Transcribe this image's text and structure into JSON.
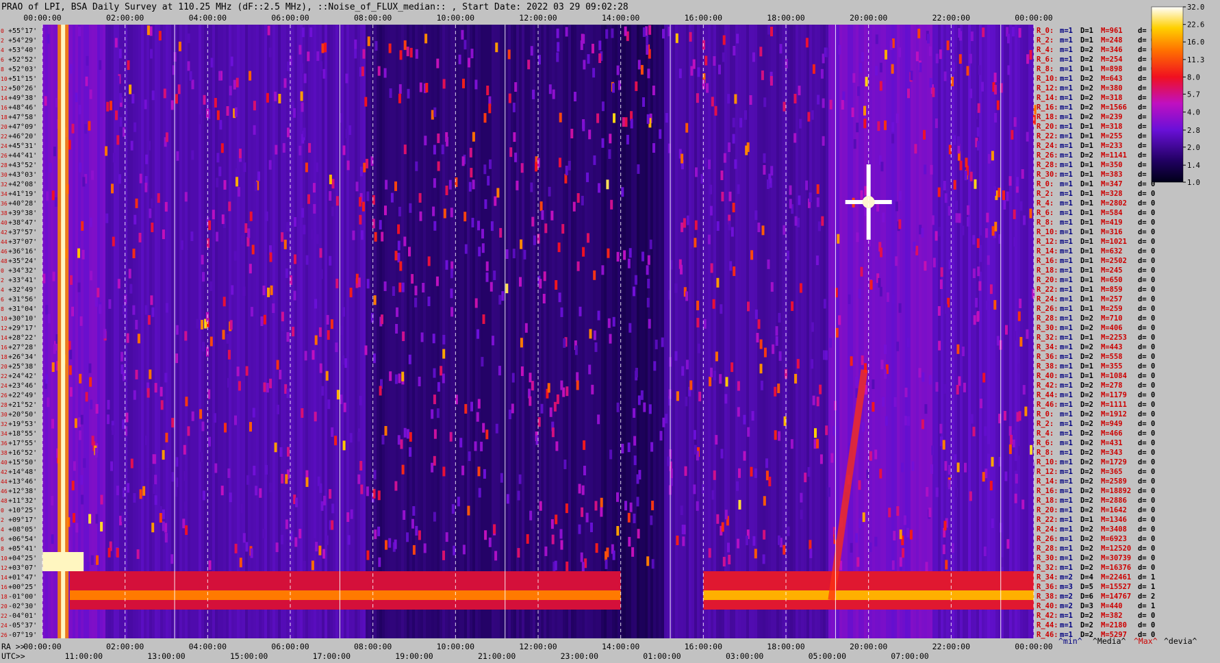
{
  "chart_data": {
    "type": "heatmap",
    "title": "PRAO of LPI, BSA Daily Survey at 110.25 MHz (dF::2.5 MHz), ::Noise_of_FLUX_median:: , Start Date: 2022 03 29 09:02:28",
    "x_axis_label_top": "",
    "x_axis_label_ra": "RA >>",
    "x_axis_label_utc": "UTC>>",
    "ra_ticks": [
      "00:00:00",
      "02:00:00",
      "04:00:00",
      "06:00:00",
      "08:00:00",
      "10:00:00",
      "12:00:00",
      "14:00:00",
      "16:00:00",
      "18:00:00",
      "20:00:00",
      "22:00:00",
      "00:00:00"
    ],
    "ra_ticks_bottom": [
      "00:00:00",
      "02:00:00",
      "04:00:00",
      "06:00:00",
      "08:00:00",
      "10:00:00",
      "12:00:00",
      "14:00:00",
      "16:00:00",
      "18:00:00",
      "20:00:00",
      "22:00:00",
      "00:00:00"
    ],
    "utc_ticks": [
      "11:00:00",
      "13:00:00",
      "15:00:00",
      "17:00:00",
      "19:00:00",
      "21:00:00",
      "23:00:00",
      "01:00:00",
      "03:00:00",
      "05:00:00",
      "07:00:00"
    ],
    "declinations": [
      "+55°17'",
      "+54°29'",
      "+53°40'",
      "+52°52'",
      "+52°03'",
      "+51°15'",
      "+50°26'",
      "+49°38'",
      "+48°46'",
      "+47°58'",
      "+47°09'",
      "+46°20'",
      "+45°31'",
      "+44°41'",
      "+43°52'",
      "+43°03'",
      "+42°08'",
      "+41°19'",
      "+40°28'",
      "+39°38'",
      "+38°47'",
      "+37°57'",
      "+37°07'",
      "+36°16'",
      "+35°24'",
      "+34°32'",
      "+33°41'",
      "+32°49'",
      "+31°56'",
      "+31°04'",
      "+30°10'",
      "+29°17'",
      "+28°22'",
      "+27°28'",
      "+26°34'",
      "+25°38'",
      "+24°42'",
      "+23°46'",
      "+22°49'",
      "+21°52'",
      "+20°50'",
      "+19°53'",
      "+18°55'",
      "+17°55'",
      "+16°52'",
      "+15°50'",
      "+14°48'",
      "+13°46'",
      "+12°38'",
      "+11°32'",
      "+10°25'",
      "+09°17'",
      "+08°05'",
      "+06°54'",
      "+05°41'",
      "+04°25'",
      "+03°07'",
      "+01°47'",
      "+00°25'",
      "-01°00'",
      "-02°30'",
      "-04°01'",
      "-05°37'",
      "-07°19'"
    ],
    "row_index": [
      "0",
      "2",
      "4",
      "6",
      "8",
      "10",
      "12",
      "14",
      "16",
      "18",
      "20",
      "22",
      "24",
      "26",
      "28",
      "30",
      "32",
      "34",
      "36",
      "38",
      "40",
      "42",
      "44",
      "46",
      "48",
      "0",
      "2",
      "4",
      "6",
      "8",
      "10",
      "12",
      "14",
      "16",
      "18",
      "20",
      "22",
      "24",
      "26",
      "28",
      "30",
      "32",
      "34",
      "36",
      "38",
      "40",
      "42",
      "44",
      "46",
      "48",
      "0",
      "2",
      "4",
      "6",
      "8",
      "10",
      "12",
      "14",
      "16",
      "18",
      "20",
      "22",
      "24",
      "26"
    ],
    "stats": [
      {
        "r": "R_0:",
        "m": "m=1",
        "D": "D=1",
        "M": "M=961",
        "d": "d= 0"
      },
      {
        "r": "R_2:",
        "m": "m=1",
        "D": "D=1",
        "M": "M=248",
        "d": "d= 0"
      },
      {
        "r": "R_4:",
        "m": "m=1",
        "D": "D=2",
        "M": "M=346",
        "d": "d= 0"
      },
      {
        "r": "R_6:",
        "m": "m=1",
        "D": "D=2",
        "M": "M=254",
        "d": "d= 0"
      },
      {
        "r": "R_8:",
        "m": "m=1",
        "D": "D=1",
        "M": "M=898",
        "d": "d= 0"
      },
      {
        "r": "R_10:",
        "m": "m=1",
        "D": "D=2",
        "M": "M=643",
        "d": "d="
      },
      {
        "r": "R_12:",
        "m": "m=1",
        "D": "D=2",
        "M": "M=380",
        "d": "d="
      },
      {
        "r": "R_14:",
        "m": "m=1",
        "D": "D=2",
        "M": "M=318",
        "d": "d="
      },
      {
        "r": "R_16:",
        "m": "m=1",
        "D": "D=2",
        "M": "M=1566",
        "d": "d="
      },
      {
        "r": "R_18:",
        "m": "m=1",
        "D": "D=2",
        "M": "M=239",
        "d": "d="
      },
      {
        "r": "R_20:",
        "m": "m=1",
        "D": "D=1",
        "M": "M=318",
        "d": "d="
      },
      {
        "r": "R_22:",
        "m": "m=1",
        "D": "D=1",
        "M": "M=255",
        "d": "d="
      },
      {
        "r": "R_24:",
        "m": "m=1",
        "D": "D=1",
        "M": "M=233",
        "d": "d="
      },
      {
        "r": "R_26:",
        "m": "m=1",
        "D": "D=2",
        "M": "M=1141",
        "d": "d="
      },
      {
        "r": "R_28:",
        "m": "m=1",
        "D": "D=1",
        "M": "M=350",
        "d": "d="
      },
      {
        "r": "R_30:",
        "m": "m=1",
        "D": "D=1",
        "M": "M=383",
        "d": "d="
      },
      {
        "r": "R_0:",
        "m": "m=1",
        "D": "D=1",
        "M": "M=347",
        "d": "d= 0"
      },
      {
        "r": "R_2:",
        "m": "m=1",
        "D": "D=1",
        "M": "M=328",
        "d": "d= 0"
      },
      {
        "r": "R_4:",
        "m": "m=1",
        "D": "D=1",
        "M": "M=2802",
        "d": "d= 0"
      },
      {
        "r": "R_6:",
        "m": "m=1",
        "D": "D=1",
        "M": "M=584",
        "d": "d= 0"
      },
      {
        "r": "R_8:",
        "m": "m=1",
        "D": "D=1",
        "M": "M=419",
        "d": "d= 0"
      },
      {
        "r": "R_10:",
        "m": "m=1",
        "D": "D=1",
        "M": "M=316",
        "d": "d= 0"
      },
      {
        "r": "R_12:",
        "m": "m=1",
        "D": "D=1",
        "M": "M=1021",
        "d": "d= 0"
      },
      {
        "r": "R_14:",
        "m": "m=1",
        "D": "D=1",
        "M": "M=632",
        "d": "d= 0"
      },
      {
        "r": "R_16:",
        "m": "m=1",
        "D": "D=1",
        "M": "M=2502",
        "d": "d= 0"
      },
      {
        "r": "R_18:",
        "m": "m=1",
        "D": "D=1",
        "M": "M=245",
        "d": "d= 0"
      },
      {
        "r": "R_20:",
        "m": "m=1",
        "D": "D=1",
        "M": "M=650",
        "d": "d= 0"
      },
      {
        "r": "R_22:",
        "m": "m=1",
        "D": "D=1",
        "M": "M=859",
        "d": "d= 0"
      },
      {
        "r": "R_24:",
        "m": "m=1",
        "D": "D=1",
        "M": "M=257",
        "d": "d= 0"
      },
      {
        "r": "R_26:",
        "m": "m=1",
        "D": "D=1",
        "M": "M=259",
        "d": "d= 0"
      },
      {
        "r": "R_28:",
        "m": "m=1",
        "D": "D=2",
        "M": "M=710",
        "d": "d= 0"
      },
      {
        "r": "R_30:",
        "m": "m=1",
        "D": "D=2",
        "M": "M=406",
        "d": "d= 0"
      },
      {
        "r": "R_32:",
        "m": "m=1",
        "D": "D=1",
        "M": "M=2253",
        "d": "d= 0"
      },
      {
        "r": "R_34:",
        "m": "m=1",
        "D": "D=2",
        "M": "M=443",
        "d": "d= 0"
      },
      {
        "r": "R_36:",
        "m": "m=1",
        "D": "D=2",
        "M": "M=558",
        "d": "d= 0"
      },
      {
        "r": "R_38:",
        "m": "m=1",
        "D": "D=1",
        "M": "M=355",
        "d": "d= 0"
      },
      {
        "r": "R_40:",
        "m": "m=1",
        "D": "D=1",
        "M": "M=1084",
        "d": "d= 0"
      },
      {
        "r": "R_42:",
        "m": "m=1",
        "D": "D=2",
        "M": "M=278",
        "d": "d= 0"
      },
      {
        "r": "R_44:",
        "m": "m=1",
        "D": "D=2",
        "M": "M=1179",
        "d": "d= 0"
      },
      {
        "r": "R_46:",
        "m": "m=1",
        "D": "D=2",
        "M": "M=1111",
        "d": "d= 0"
      },
      {
        "r": "R_0:",
        "m": "m=1",
        "D": "D=2",
        "M": "M=1912",
        "d": "d= 0"
      },
      {
        "r": "R_2:",
        "m": "m=1",
        "D": "D=2",
        "M": "M=949",
        "d": "d= 0"
      },
      {
        "r": "R_4:",
        "m": "m=1",
        "D": "D=2",
        "M": "M=466",
        "d": "d= 0"
      },
      {
        "r": "R_6:",
        "m": "m=1",
        "D": "D=2",
        "M": "M=431",
        "d": "d= 0"
      },
      {
        "r": "R_8:",
        "m": "m=1",
        "D": "D=2",
        "M": "M=343",
        "d": "d= 0"
      },
      {
        "r": "R_10:",
        "m": "m=1",
        "D": "D=2",
        "M": "M=1729",
        "d": "d= 0"
      },
      {
        "r": "R_12:",
        "m": "m=1",
        "D": "D=2",
        "M": "M=365",
        "d": "d= 0"
      },
      {
        "r": "R_14:",
        "m": "m=1",
        "D": "D=2",
        "M": "M=2589",
        "d": "d= 0"
      },
      {
        "r": "R_16:",
        "m": "m=1",
        "D": "D=2",
        "M": "M=18892",
        "d": "d= 0"
      },
      {
        "r": "R_18:",
        "m": "m=1",
        "D": "D=2",
        "M": "M=2886",
        "d": "d= 0"
      },
      {
        "r": "R_20:",
        "m": "m=1",
        "D": "D=2",
        "M": "M=1642",
        "d": "d= 0"
      },
      {
        "r": "R_22:",
        "m": "m=1",
        "D": "D=1",
        "M": "M=1346",
        "d": "d= 0"
      },
      {
        "r": "R_24:",
        "m": "m=1",
        "D": "D=2",
        "M": "M=3408",
        "d": "d= 0"
      },
      {
        "r": "R_26:",
        "m": "m=1",
        "D": "D=2",
        "M": "M=6923",
        "d": "d= 0"
      },
      {
        "r": "R_28:",
        "m": "m=1",
        "D": "D=2",
        "M": "M=12520",
        "d": "d= 0"
      },
      {
        "r": "R_30:",
        "m": "m=1",
        "D": "D=2",
        "M": "M=30739",
        "d": "d= 0"
      },
      {
        "r": "R_32:",
        "m": "m=1",
        "D": "D=2",
        "M": "M=16376",
        "d": "d= 0"
      },
      {
        "r": "R_34:",
        "m": "m=2",
        "D": "D=4",
        "M": "M=22461",
        "d": "d= 1"
      },
      {
        "r": "R_36:",
        "m": "m=3",
        "D": "D=5",
        "M": "M=15527",
        "d": "d= 1"
      },
      {
        "r": "R_38:",
        "m": "m=2",
        "D": "D=6",
        "M": "M=14767",
        "d": "d= 2"
      },
      {
        "r": "R_40:",
        "m": "m=2",
        "D": "D=3",
        "M": "M=440",
        "d": "d= 1"
      },
      {
        "r": "R_42:",
        "m": "m=1",
        "D": "D=2",
        "M": "M=382",
        "d": "d= 0"
      },
      {
        "r": "R_44:",
        "m": "m=1",
        "D": "D=2",
        "M": "M=2180",
        "d": "d= 0"
      },
      {
        "r": "R_46:",
        "m": "m=1",
        "D": "D=2",
        "M": "M=5297",
        "d": "d= 0"
      }
    ],
    "legend_labels": [
      "^min^",
      "^Media^",
      "^Max^",
      "^devia^"
    ],
    "colorbar": {
      "ticks": [
        "32.0",
        "22.6",
        "16.0",
        "11.3",
        "8.0",
        "5.7",
        "4.0",
        "2.8",
        "2.0",
        "1.4",
        "1.0"
      ],
      "tick_values": [
        32.0,
        22.6,
        16.0,
        11.3,
        8.0,
        5.7,
        4.0,
        2.8,
        2.0,
        1.4,
        1.0
      ],
      "scale": "log",
      "range": [
        1.0,
        32.0
      ]
    },
    "features": {
      "bright_vertical_source_ra_hours": 0.5,
      "bright_point_source_ra_hours": 20.0,
      "bright_point_source_dec": "+40°28'",
      "horizontal_band_dec_range": [
        "+01°47'",
        "-01°00'"
      ],
      "band_gap_ra_hours": [
        14.0,
        16.0
      ]
    },
    "colors": {
      "background": "#c2c2c2",
      "stat_m_color": "#000080",
      "stat_D_color": "#000000",
      "stat_M_color": "#cc0000",
      "stat_r_color": "#cc0000"
    }
  }
}
